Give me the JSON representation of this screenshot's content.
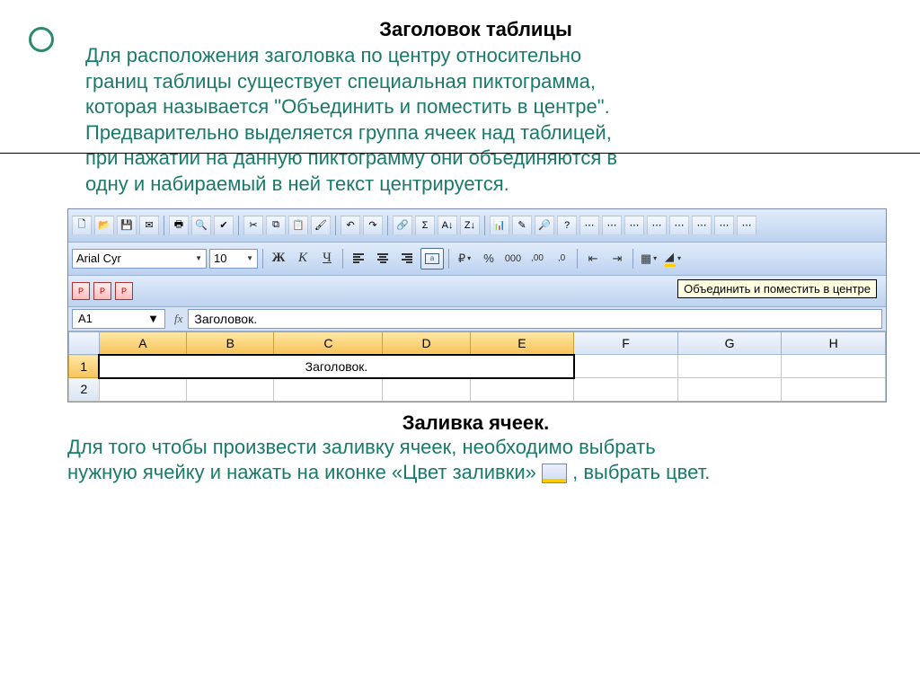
{
  "slide": {
    "bullet_icon": "hollow-circle",
    "heading1": "Заголовок таблицы",
    "paragraph1_line1": "Для расположения заголовка по центру относительно",
    "paragraph1_line2": "границ таблицы существует специальная пиктограмма,",
    "paragraph1_line3": "которая называется \"Объединить и поместить в центре\".",
    "paragraph1_line4": "Предварительно выделяется группа ячеек над таблицей,",
    "paragraph1_line5": "при нажатии на данную пиктограмму они объединяются в",
    "paragraph1_line6": "одну и набираемый в ней текст центрируется.",
    "heading2": "Заливка ячеек.",
    "paragraph2_line1": "Для того чтобы произвести заливку ячеек, необходимо выбрать",
    "paragraph2_line2": "нужную ячейку и нажать на иконке «Цвет заливки»",
    "paragraph2_tail": ", выбрать цвет."
  },
  "excel": {
    "font_name": "Arial Cyr",
    "font_size": "10",
    "bold_label": "Ж",
    "italic_label": "К",
    "underline_label": "Ч",
    "currency_label": "₽",
    "percent_label": "%",
    "thousands_label": "000",
    "dec_inc_label": ",00",
    "dec_dec_label": ",0",
    "tooltip": "Объединить и поместить в центре",
    "cell_ref": "A1",
    "fx_label": "fx",
    "formula_value": "Заголовок.",
    "columns": [
      "A",
      "B",
      "C",
      "D",
      "E",
      "F",
      "G",
      "H"
    ],
    "rows": [
      "1",
      "2"
    ],
    "merged_text": "Заголовок."
  }
}
